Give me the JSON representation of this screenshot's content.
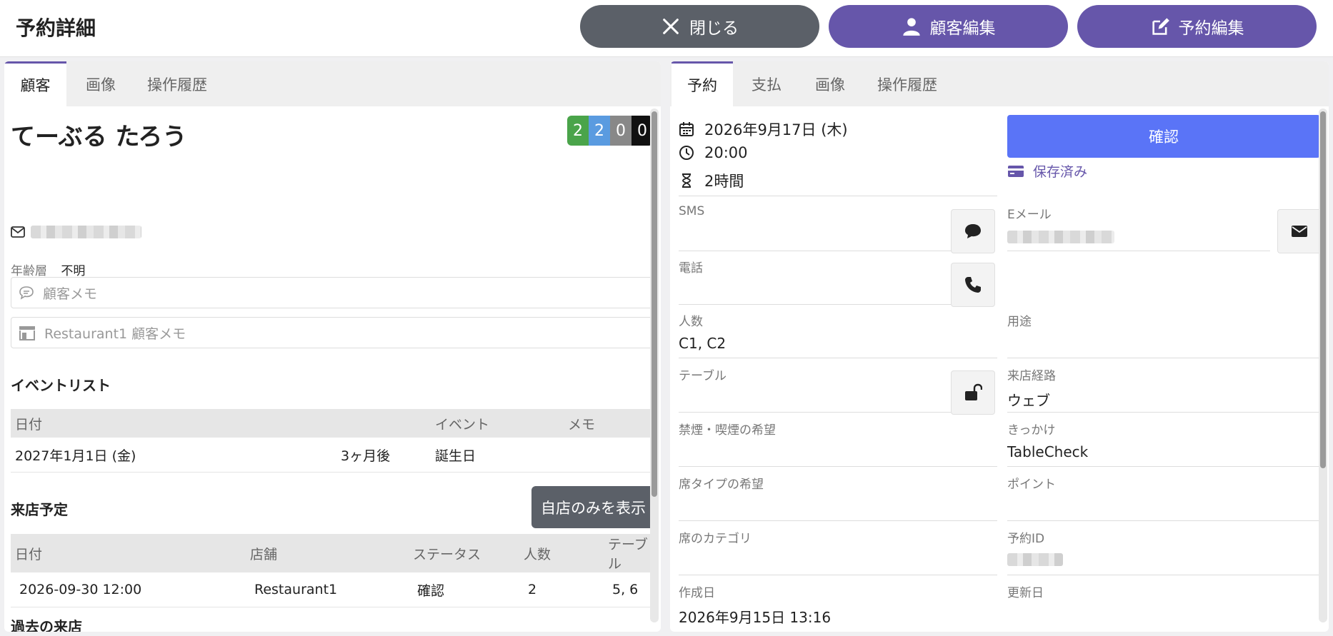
{
  "header": {
    "title": "予約詳細",
    "close_label": "閉じる",
    "edit_customer_label": "顧客編集",
    "edit_booking_label": "予約編集"
  },
  "left": {
    "tabs": [
      "顧客",
      "画像",
      "操作履歴"
    ],
    "customer_name": "てーぶる たろう",
    "counts": [
      {
        "value": "2",
        "color": "#4aa44a"
      },
      {
        "value": "2",
        "color": "#5a9be0"
      },
      {
        "value": "0",
        "color": "#888888"
      },
      {
        "value": "0",
        "color": "#111111"
      }
    ],
    "age_label": "年齢層",
    "age_value": "不明",
    "customer_memo_placeholder": "顧客メモ",
    "restaurant_memo_placeholder": "Restaurant1 顧客メモ",
    "events": {
      "title": "イベントリスト",
      "headers": [
        "日付",
        "",
        "イベント",
        "メモ"
      ],
      "rows": [
        [
          "2027年1月1日 (金)",
          "3ヶ月後",
          "誕生日",
          ""
        ]
      ]
    },
    "upcoming": {
      "title": "来店予定",
      "filter_button": "自店のみを表示",
      "headers": [
        "日付",
        "店舗",
        "ステータス",
        "人数",
        "テーブル"
      ],
      "rows": [
        [
          "2026-09-30 12:00",
          "Restaurant1",
          "確認",
          "2",
          "5, 6"
        ]
      ]
    },
    "past_title": "過去の来店"
  },
  "right": {
    "tabs": [
      "予約",
      "支払",
      "画像",
      "操作履歴"
    ],
    "date": "2026年9月17日 (木)",
    "time": "20:00",
    "duration": "2時間",
    "confirm_label": "確認",
    "saved_label": "保存済み",
    "fields": {
      "sms": "SMS",
      "email": "Eメール",
      "phone": "電話",
      "guests": "人数",
      "guests_value": "C1, C2",
      "purpose": "用途",
      "table": "テーブル",
      "source": "来店経路",
      "source_value": "ウェブ",
      "smoking": "禁煙・喫煙の希望",
      "trigger": "きっかけ",
      "trigger_value": "TableCheck",
      "seat_type": "席タイプの希望",
      "points": "ポイント",
      "seat_category": "席のカテゴリ",
      "reservation_id": "予約ID",
      "created": "作成日",
      "created_value": "2026年9月15日 13:16",
      "updated": "更新日"
    }
  },
  "colors": {
    "accent": "#6656aa",
    "confirm": "#5a74f7",
    "close_button": "#5b6068"
  }
}
